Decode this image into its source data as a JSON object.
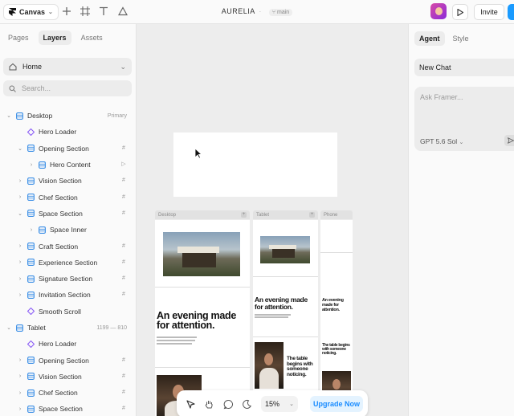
{
  "topbar": {
    "app_menu_label": "Canvas",
    "project_name": "AURELIA",
    "branch": "main",
    "invite_label": "Invite"
  },
  "left_panel": {
    "tabs": [
      {
        "label": "Pages",
        "active": false
      },
      {
        "label": "Layers",
        "active": true
      },
      {
        "label": "Assets",
        "active": false
      }
    ],
    "page_select": "Home",
    "search_placeholder": "Search...",
    "layers": [
      {
        "label": "Desktop",
        "depth": 0,
        "twisty": "open",
        "icon": "frame",
        "meta": "Primary",
        "right": ""
      },
      {
        "label": "Hero Loader",
        "depth": 1,
        "twisty": "",
        "icon": "component",
        "meta": "",
        "right": ""
      },
      {
        "label": "Opening Section",
        "depth": 1,
        "twisty": "open",
        "icon": "frame",
        "meta": "",
        "right": "grid"
      },
      {
        "label": "Hero Content",
        "depth": 2,
        "twisty": "closed",
        "icon": "frame",
        "meta": "",
        "right": "link"
      },
      {
        "label": "Vision Section",
        "depth": 1,
        "twisty": "closed",
        "icon": "frame",
        "meta": "",
        "right": "grid"
      },
      {
        "label": "Chef Section",
        "depth": 1,
        "twisty": "closed",
        "icon": "frame",
        "meta": "",
        "right": "grid"
      },
      {
        "label": "Space Section",
        "depth": 1,
        "twisty": "open",
        "icon": "frame",
        "meta": "",
        "right": "grid"
      },
      {
        "label": "Space Inner",
        "depth": 2,
        "twisty": "closed",
        "icon": "frame",
        "meta": "",
        "right": ""
      },
      {
        "label": "Craft Section",
        "depth": 1,
        "twisty": "closed",
        "icon": "frame",
        "meta": "",
        "right": "grid"
      },
      {
        "label": "Experience Section",
        "depth": 1,
        "twisty": "closed",
        "icon": "frame",
        "meta": "",
        "right": "grid"
      },
      {
        "label": "Signature Section",
        "depth": 1,
        "twisty": "closed",
        "icon": "frame",
        "meta": "",
        "right": "grid"
      },
      {
        "label": "Invitation Section",
        "depth": 1,
        "twisty": "closed",
        "icon": "frame",
        "meta": "",
        "right": "grid"
      },
      {
        "label": "Smooth Scroll",
        "depth": 1,
        "twisty": "",
        "icon": "component",
        "meta": "",
        "right": ""
      },
      {
        "label": "Tablet",
        "depth": 0,
        "twisty": "open",
        "icon": "frame",
        "meta": "1199 — 810",
        "right": ""
      },
      {
        "label": "Hero Loader",
        "depth": 1,
        "twisty": "",
        "icon": "component",
        "meta": "",
        "right": ""
      },
      {
        "label": "Opening Section",
        "depth": 1,
        "twisty": "closed",
        "icon": "frame",
        "meta": "",
        "right": "grid"
      },
      {
        "label": "Vision Section",
        "depth": 1,
        "twisty": "closed",
        "icon": "frame",
        "meta": "",
        "right": "grid"
      },
      {
        "label": "Chef Section",
        "depth": 1,
        "twisty": "closed",
        "icon": "frame",
        "meta": "",
        "right": "grid"
      },
      {
        "label": "Space Section",
        "depth": 1,
        "twisty": "closed",
        "icon": "frame",
        "meta": "",
        "right": "grid"
      }
    ]
  },
  "canvas": {
    "breakpoints": [
      {
        "label": "Desktop"
      },
      {
        "label": "Tablet"
      },
      {
        "label": "Phone"
      }
    ],
    "headline": "An evening made for attention.",
    "chef_headline": "The table begins with someone noticing."
  },
  "bottom_bar": {
    "zoom": "15%",
    "upgrade_label": "Upgrade Now"
  },
  "right_panel": {
    "tabs": [
      {
        "label": "Agent",
        "active": true
      },
      {
        "label": "Style",
        "active": false
      }
    ],
    "chat_select": "New Chat",
    "input_placeholder": "Ask Framer...",
    "model": "GPT 5.6 Sol"
  },
  "colors": {
    "accent": "#1a9bff",
    "layer_frame_icon": "#3a8ee6",
    "layer_component_icon": "#8a5cf6"
  }
}
